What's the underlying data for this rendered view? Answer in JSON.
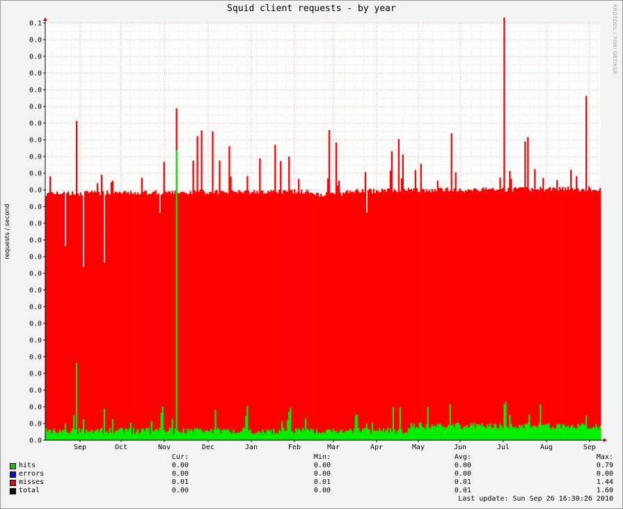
{
  "title": "Squid client requests - by year",
  "watermark": "RRDTOOL / TOBI OETIKER",
  "chart_data": {
    "type": "area",
    "title": "Squid client requests - by year",
    "ylabel": "requests / second",
    "xlabel": "",
    "y_tick_labels": [
      "0.0",
      "0.0",
      "0.0",
      "0.0",
      "0.0",
      "0.0",
      "0.0",
      "0.0",
      "0.0",
      "0.0",
      "0.0",
      "0.0",
      "0.0",
      "0.0",
      "0.0",
      "0.0",
      "0.0",
      "0.0",
      "0.0",
      "0.0",
      "0.0",
      "0.0",
      "0.0",
      "0.0",
      "0.0",
      "0.1"
    ],
    "ylim": [
      0,
      0.1
    ],
    "x_tick_labels": [
      "Sep",
      "Oct",
      "Nov",
      "Dec",
      "Jan",
      "Feb",
      "Mar",
      "Apr",
      "May",
      "Jun",
      "Jul",
      "Aug",
      "Sep"
    ],
    "grid": true,
    "legend_position": "bottom",
    "colors": {
      "hits": "#00ee00",
      "errors": "#0000ff",
      "misses": "#ff0000",
      "total": "#000000",
      "grid": "#ff9999",
      "frame": "#000000"
    },
    "approx_series_levels": {
      "misses_baseline": 0.059,
      "hits_baseline": 0.002,
      "misses_spikes_note_removed": true
    },
    "spikes": [
      {
        "x": 0.035,
        "misses": 0.0465,
        "hits": 0.004
      },
      {
        "x": 0.055,
        "misses": 0.0765,
        "hits": 0.0185
      },
      {
        "x": 0.067,
        "misses": 0.0415,
        "hits": 0.005
      },
      {
        "x": 0.104,
        "misses": 0.0425,
        "hits": 0.0075
      },
      {
        "x": 0.205,
        "misses": 0.0545,
        "hits": 0.003
      },
      {
        "x": 0.236,
        "misses": 0.0795,
        "hits": 0.0695
      },
      {
        "x": 0.577,
        "misses": 0.0545,
        "hits": 0.004
      },
      {
        "x": 0.825,
        "misses": 0.108,
        "hits": 0.0085
      },
      {
        "x": 0.836,
        "misses": 0.0645,
        "hits": 0.006
      },
      {
        "x": 0.973,
        "misses": 0.0825,
        "hits": 0.006
      }
    ]
  },
  "legend": {
    "headers": {
      "cur": "Cur:",
      "min": "Min:",
      "avg": "Avg:",
      "max": "Max:"
    },
    "rows": [
      {
        "name": "hits",
        "color": "#00cc00",
        "cur": "0.00",
        "min": "0.00",
        "avg": "0.00",
        "max": "0.79"
      },
      {
        "name": "errors",
        "color": "#0000ff",
        "cur": "0.00",
        "min": "0.00",
        "avg": "0.00",
        "max": "0.00"
      },
      {
        "name": "misses",
        "color": "#ff0000",
        "cur": "0.01",
        "min": "0.01",
        "avg": "0.01",
        "max": "1.44"
      },
      {
        "name": "total",
        "color": "#000000",
        "cur": "0.00",
        "min": "0.00",
        "avg": "0.01",
        "max": "1.60"
      }
    ]
  },
  "last_update": "Last update: Sun Sep 26 16:30:26 2010"
}
